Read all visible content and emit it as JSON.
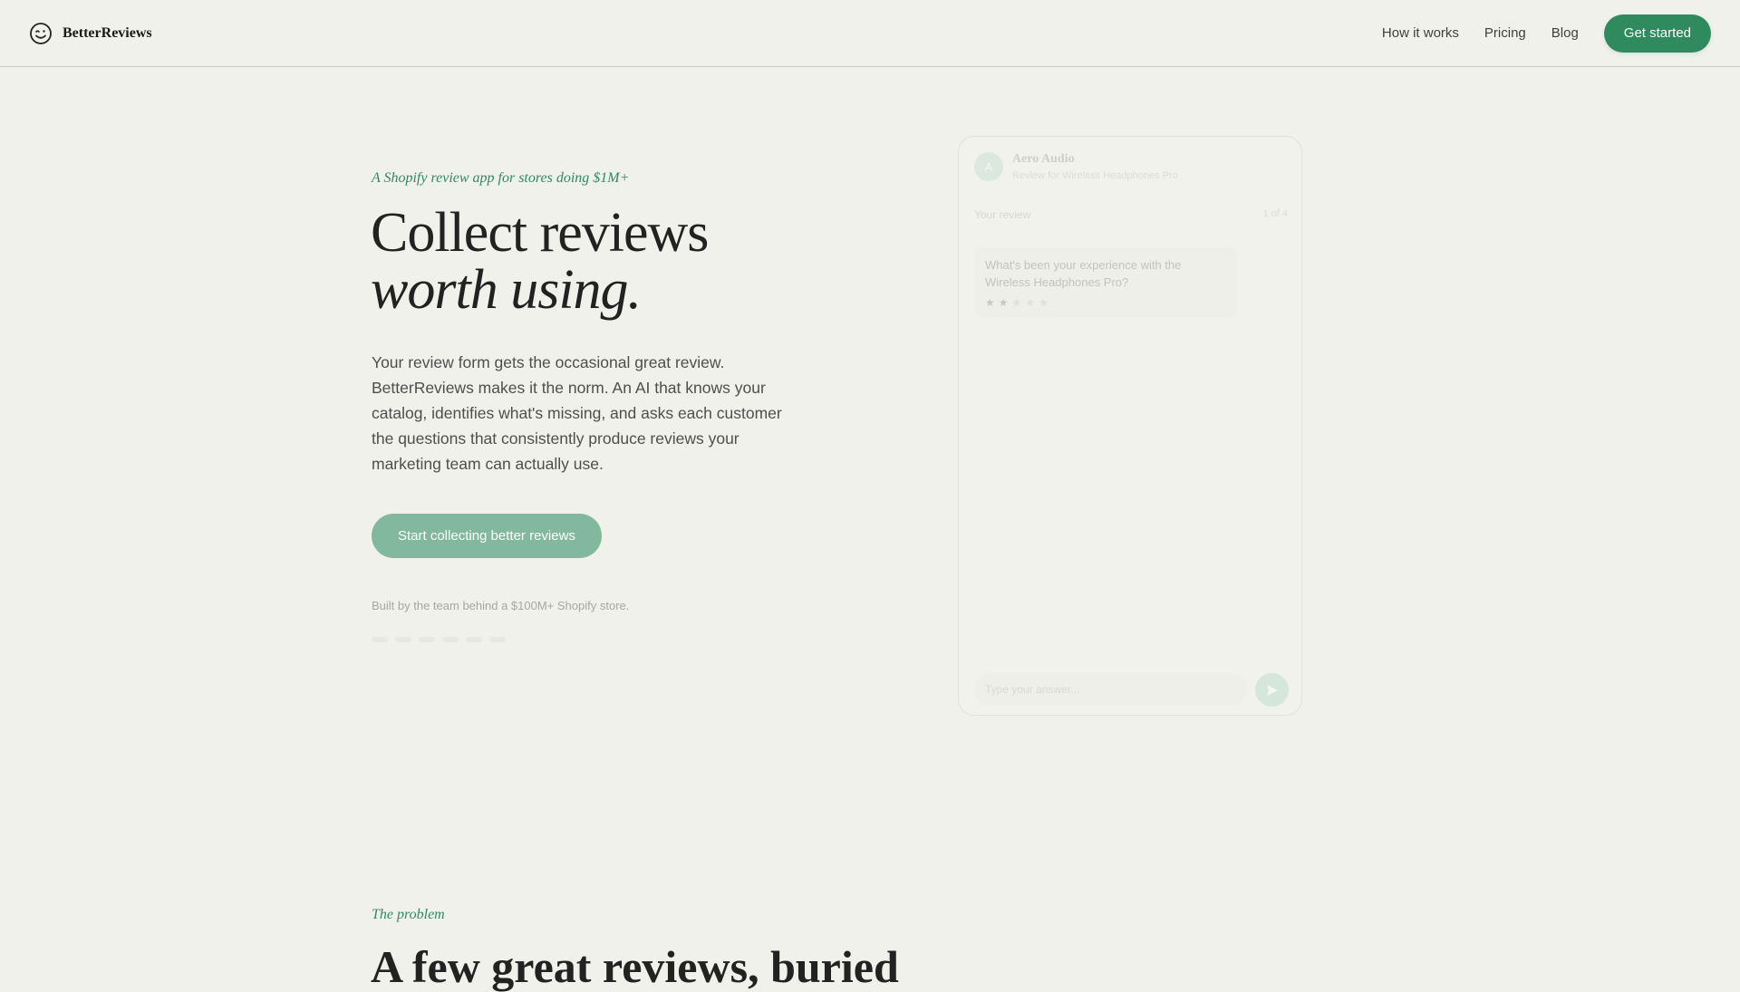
{
  "nav": {
    "brand": "BetterReviews",
    "links": [
      "How it works",
      "Pricing",
      "Blog"
    ],
    "cta": "Get started"
  },
  "hero": {
    "eyebrow": "A Shopify review app for stores doing $1M+",
    "headline_line1": "Collect reviews",
    "headline_line2": "worth using.",
    "body": "Your review form gets the occasional great review. BetterReviews makes it the norm. An AI that knows your catalog, identifies what's missing, and asks each customer the questions that consistently produce reviews your marketing team can actually use.",
    "cta": "Start collecting better reviews",
    "social_proof": "Built by the team behind a $100M+ Shopify store."
  },
  "mock_chat": {
    "avatar_letter": "A",
    "store_name": "Aero Audio",
    "subtitle": "Review for Wireless Headphones Pro",
    "label": "Your review",
    "progress": "1 of 4",
    "question": "What's been your experience with the Wireless Headphones Pro?",
    "stars_filled": 2,
    "stars_total": 5,
    "input_placeholder": "Type your answer..."
  },
  "problem": {
    "eyebrow": "The problem",
    "title": "A few great reviews, buried"
  },
  "colors": {
    "background": "#f1f1ec",
    "accent": "#2f8a5e",
    "accent_light": "#82b99c"
  },
  "icons": {
    "brand": "smiley-wink-icon",
    "send": "send-arrow-icon"
  }
}
